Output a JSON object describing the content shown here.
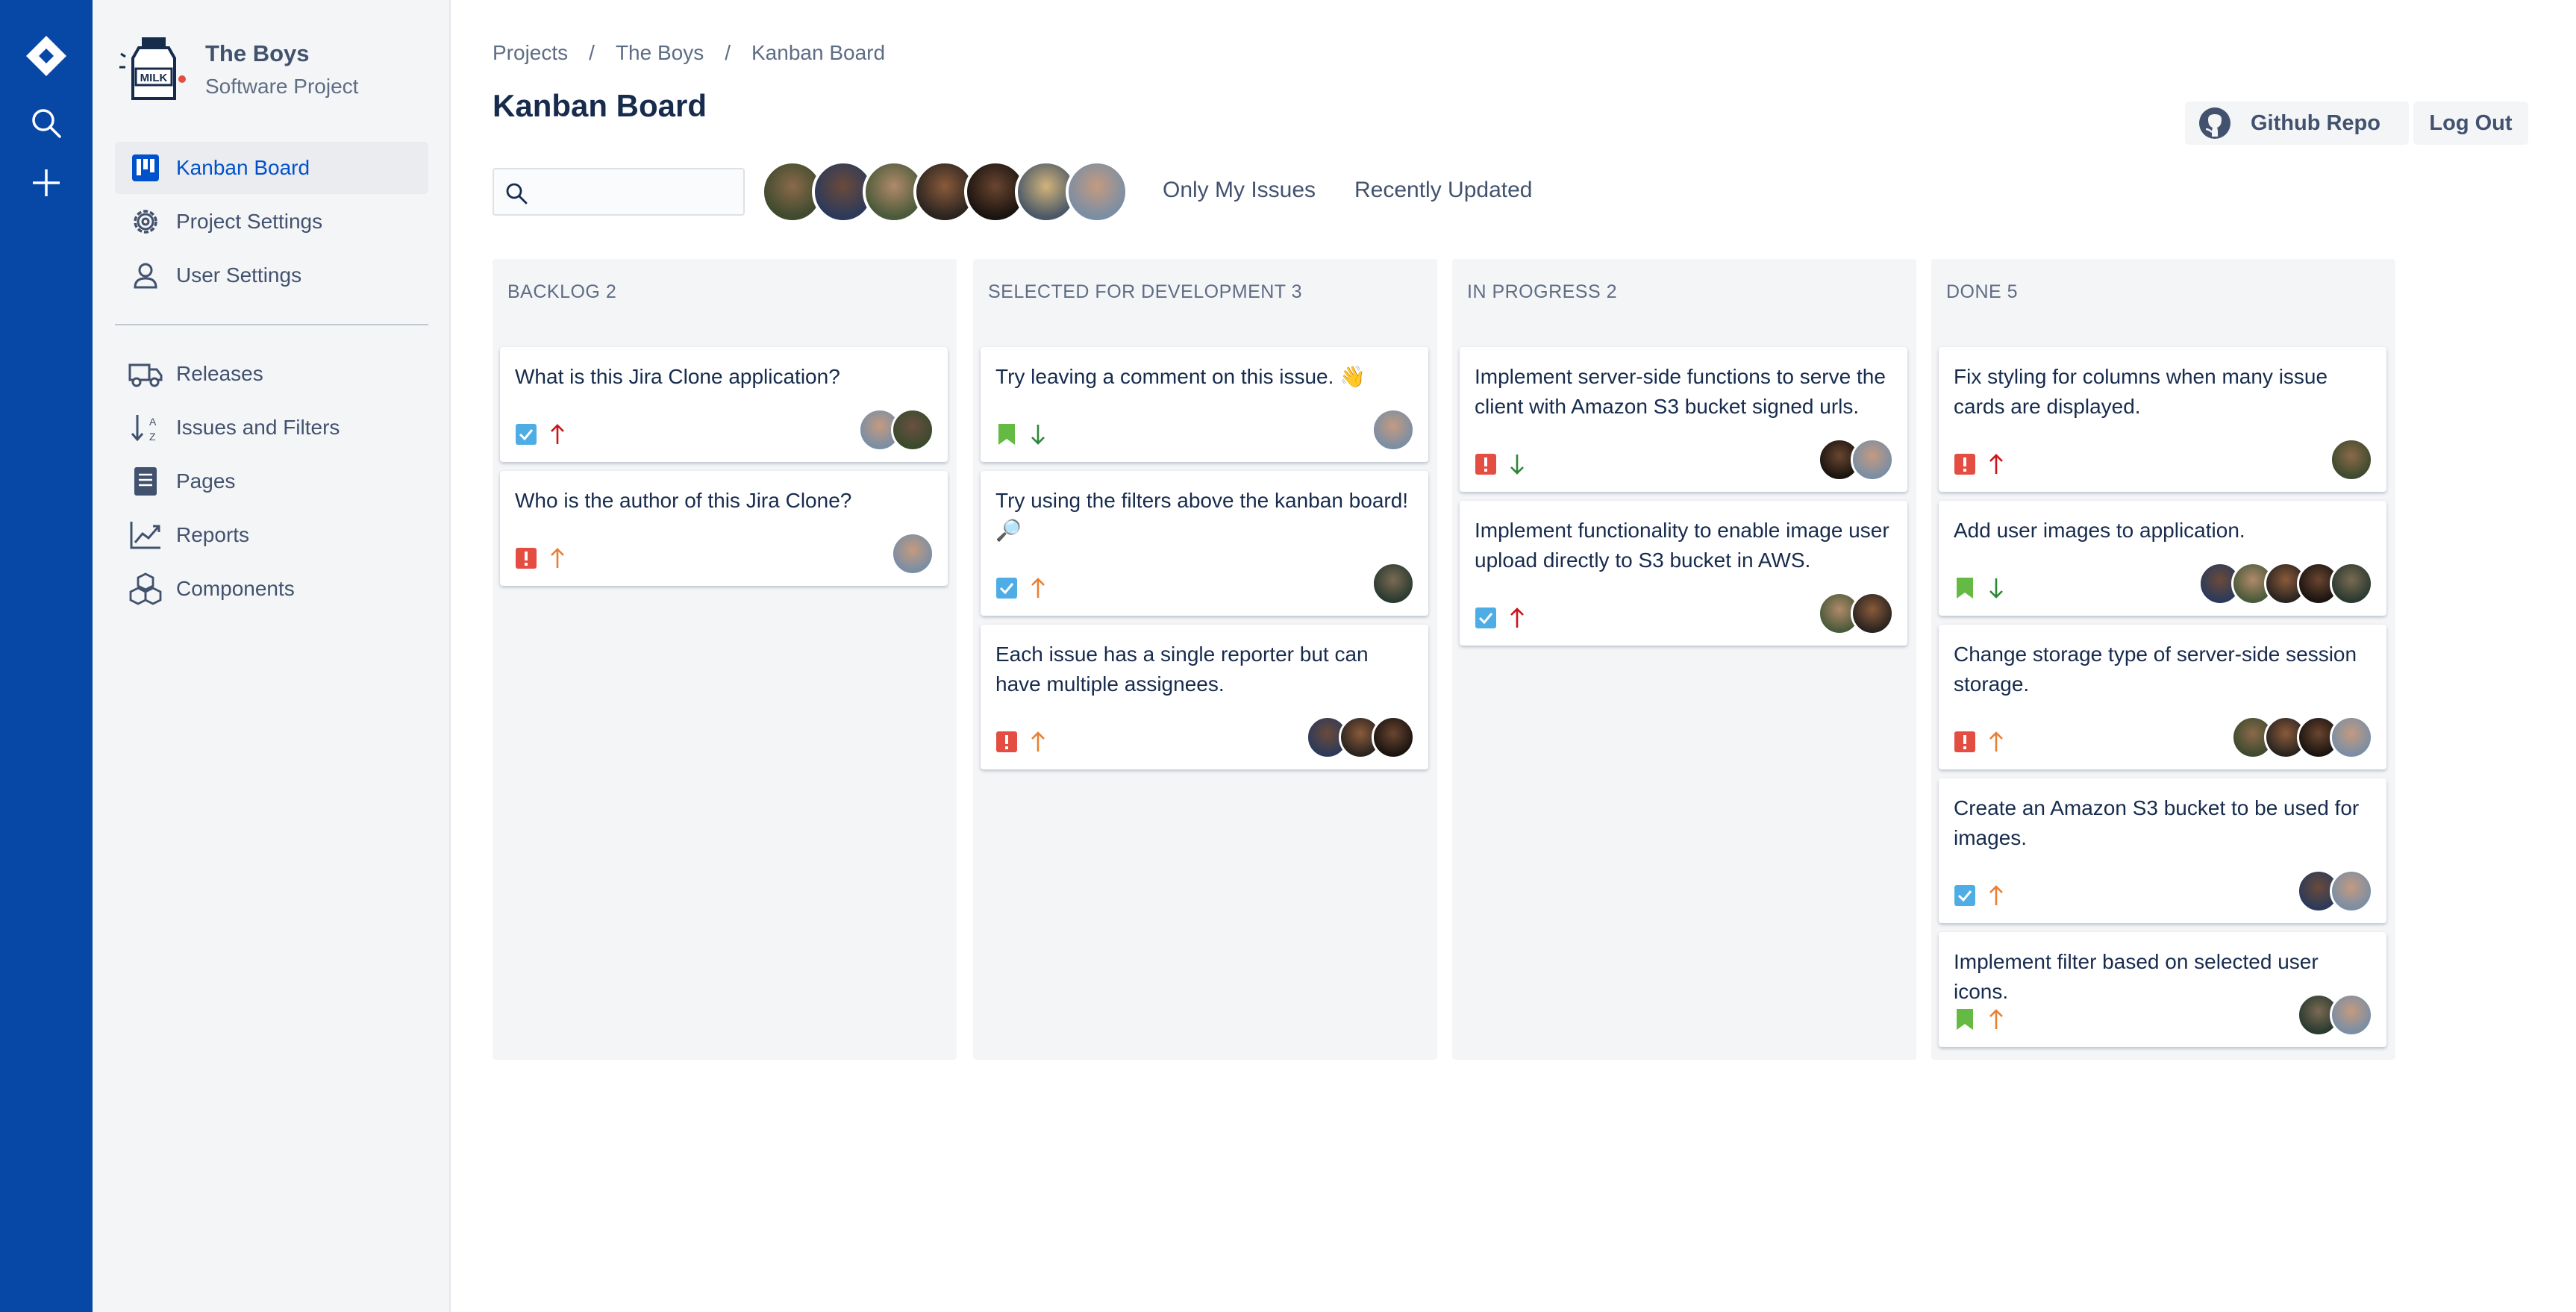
{
  "project": {
    "name": "The Boys",
    "category": "Software Project"
  },
  "sidebar": {
    "items": [
      {
        "label": "Kanban Board",
        "icon": "board-icon"
      },
      {
        "label": "Project Settings",
        "icon": "gear-icon"
      },
      {
        "label": "User Settings",
        "icon": "user-icon"
      },
      {
        "label": "Releases",
        "icon": "truck-icon"
      },
      {
        "label": "Issues and Filters",
        "icon": "sort-icon"
      },
      {
        "label": "Pages",
        "icon": "page-icon"
      },
      {
        "label": "Reports",
        "icon": "chart-icon"
      },
      {
        "label": "Components",
        "icon": "cubes-icon"
      }
    ]
  },
  "breadcrumbs": [
    "Projects",
    "The Boys",
    "Kanban Board"
  ],
  "breadcrumb_sep": "/",
  "page_title": "Kanban Board",
  "header_buttons": {
    "github": "Github Repo",
    "logout": "Log Out"
  },
  "filters": {
    "only_my_issues": "Only My Issues",
    "recently_updated": "Recently Updated"
  },
  "colors": {
    "rail": "#0747a6",
    "task": "#4fade6",
    "bug": "#e44d42",
    "story": "#65ba43",
    "priority_high": "#e97f33",
    "priority_highest": "#cd1317",
    "priority_low": "#2d8738"
  },
  "columns": [
    {
      "title": "Backlog 2",
      "cards": [
        {
          "title": "What is this Jira Clone application?",
          "type": "task",
          "priority": "highest"
        },
        {
          "title": "Who is the author of this Jira Clone?",
          "type": "bug",
          "priority": "high"
        }
      ]
    },
    {
      "title": "Selected for Development 3",
      "cards": [
        {
          "title": "Try leaving a comment on this issue. 👋",
          "type": "story",
          "priority": "low"
        },
        {
          "title": "Try using the filters above the kanban board! 🔎",
          "type": "task",
          "priority": "high"
        },
        {
          "title": "Each issue has a single reporter but can have multiple assignees.",
          "type": "bug",
          "priority": "high"
        }
      ]
    },
    {
      "title": "In Progress 2",
      "cards": [
        {
          "title": "Implement server-side functions to serve the client with Amazon S3 bucket signed urls.",
          "type": "bug",
          "priority": "low"
        },
        {
          "title": "Implement functionality to enable image user upload directly to S3 bucket in AWS.",
          "type": "task",
          "priority": "highest"
        }
      ]
    },
    {
      "title": "Done 5",
      "cards": [
        {
          "title": "Fix styling for columns when many issue cards are displayed.",
          "type": "bug",
          "priority": "highest"
        },
        {
          "title": "Add user images to application.",
          "type": "story",
          "priority": "low"
        },
        {
          "title": "Change storage type of server-side session storage.",
          "type": "bug",
          "priority": "high"
        },
        {
          "title": "Create an Amazon S3 bucket to be used for images.",
          "type": "task",
          "priority": "high"
        },
        {
          "title": "Implement filter based on selected user icons.",
          "type": "story",
          "priority": "high"
        }
      ]
    }
  ]
}
